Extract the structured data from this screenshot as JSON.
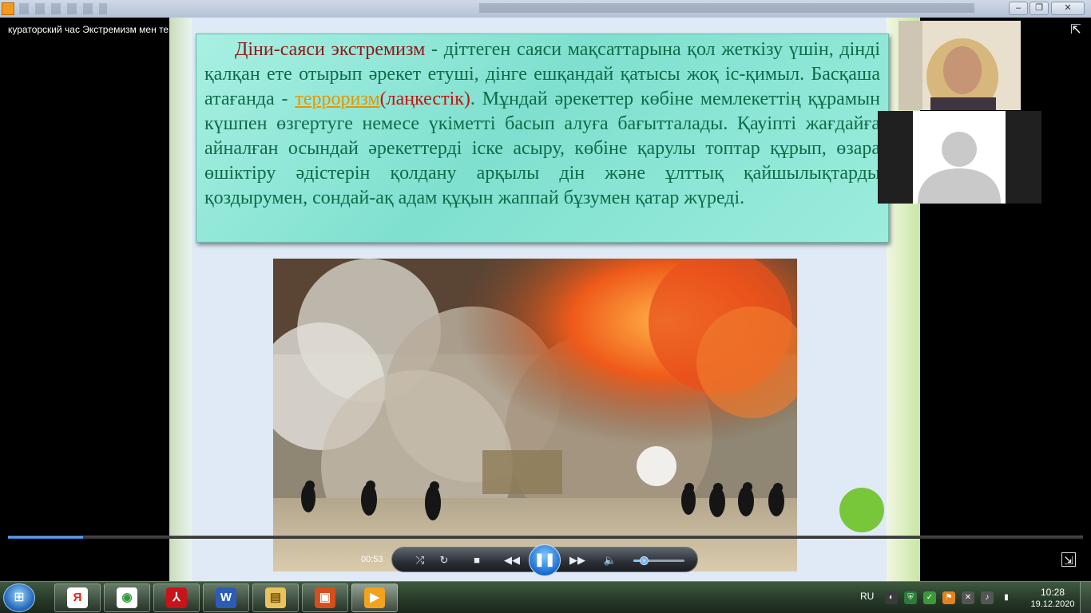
{
  "window": {
    "title": "кураторский час Экстремизм мен терроризм түсінігі, мәні, көрініс формасы",
    "minimize": "–",
    "maximize": "❐",
    "close": "✕"
  },
  "slide": {
    "term": "Діни-саяси экстремизм",
    "text_part1": " - діттеген саяси мақсаттарына қол жеткізу үшін, дінді қалқан ете отырып әрекет етуші, дінге ешқандай қатысы жоқ іс-қимыл. Басқаша атағанда - ",
    "link_term": "терроризм",
    "paren_term": "(лаңкестік)",
    "text_part2": ". Мұндай әрекеттер көбіне мемлекеттің құрамын күшпен өзгертуге немесе үкіметті басып алуға бағытталады. Қауіпті жағдайға айналған осындай әрекеттерді іске асыру, көбіне қарулы топтар құрып, өзара өшіктіру әдістерін қолдану арқылы дін және ұлттық қайшылықтарды қоздырумен, сондай-ақ адам құқын жаппай бұзумен қатар жүреді."
  },
  "player": {
    "time": "00:53",
    "progress": 0.07,
    "volume": 0.2,
    "state": "playing",
    "icons": {
      "shuffle": "⤮",
      "repeat": "↻",
      "stop": "■",
      "previous": "◀◀",
      "play_pause": "❚❚",
      "next": "▶▶",
      "volume": "🔈",
      "fullscreen": "⇱",
      "exit_fullscreen": "⇲"
    }
  },
  "taskbar": {
    "start_icon": "windows-orb-icon",
    "apps": [
      {
        "name": "yandex-browser",
        "glyph": "Я",
        "color": "#ffffff",
        "fg": "#e0251b"
      },
      {
        "name": "chrome",
        "glyph": "◉",
        "color": "#ffffff",
        "fg": "#2e9a3a"
      },
      {
        "name": "acrobat-reader",
        "glyph": "⅄",
        "color": "#c7141a",
        "fg": "#ffffff"
      },
      {
        "name": "word",
        "glyph": "W",
        "color": "#2b5cb8",
        "fg": "#ffffff"
      },
      {
        "name": "file-explorer",
        "glyph": "▤",
        "color": "#e8c25a",
        "fg": "#7a5410"
      },
      {
        "name": "powerpoint-viewer",
        "glyph": "▣",
        "color": "#d64e1b",
        "fg": "#ffffff"
      },
      {
        "name": "media-player",
        "glyph": "▶",
        "color": "#f3a21c",
        "fg": "#ffffff"
      }
    ],
    "language": "RU",
    "clock_time": "10:28",
    "clock_date": "19.12.2020"
  },
  "colors": {
    "slide_text": "#0f6b48",
    "term": "#8b1a1a",
    "link_term": "#e69500",
    "paren_term": "#c3150f",
    "textbox": "#8fe6d6",
    "accent_dot": "#78c73a"
  }
}
